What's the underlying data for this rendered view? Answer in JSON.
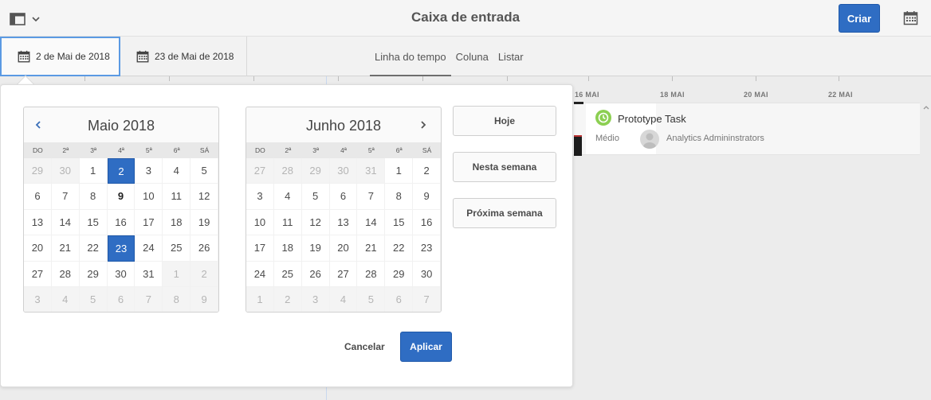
{
  "header": {
    "title": "Caixa de entrada",
    "create_label": "Criar",
    "rail_icon": "rail-toggle-icon",
    "calendar_icon": "calendar-icon"
  },
  "toolbar": {
    "start_date": "2 de Mai de 2018",
    "end_date": "23 de Mai de 2018",
    "views": [
      "Linha do tempo",
      "Coluna",
      "Listar"
    ],
    "active_view": "Linha do tempo"
  },
  "timeline": {
    "labels": [
      "16 MAI",
      "18 MAI",
      "20 MAI",
      "22 MAI"
    ],
    "task": {
      "title": "Prototype Task",
      "priority": "Médio",
      "assignee": "Analytics Admininstrators",
      "status_color": "#8ccf52"
    }
  },
  "datepicker": {
    "weekdays": [
      "DO",
      "2ª",
      "3ª",
      "4ª",
      "5ª",
      "6ª",
      "SÁ"
    ],
    "months": [
      {
        "title": "Maio 2018",
        "weeks": [
          [
            {
              "d": "29",
              "m": true
            },
            {
              "d": "30",
              "m": true
            },
            {
              "d": "1"
            },
            {
              "d": "2",
              "s": true
            },
            {
              "d": "3"
            },
            {
              "d": "4"
            },
            {
              "d": "5"
            }
          ],
          [
            {
              "d": "6"
            },
            {
              "d": "7"
            },
            {
              "d": "8"
            },
            {
              "d": "9",
              "t": true
            },
            {
              "d": "10"
            },
            {
              "d": "11"
            },
            {
              "d": "12"
            }
          ],
          [
            {
              "d": "13"
            },
            {
              "d": "14"
            },
            {
              "d": "15"
            },
            {
              "d": "16"
            },
            {
              "d": "17"
            },
            {
              "d": "18"
            },
            {
              "d": "19"
            }
          ],
          [
            {
              "d": "20"
            },
            {
              "d": "21"
            },
            {
              "d": "22"
            },
            {
              "d": "23",
              "s": true
            },
            {
              "d": "24"
            },
            {
              "d": "25"
            },
            {
              "d": "26"
            }
          ],
          [
            {
              "d": "27"
            },
            {
              "d": "28"
            },
            {
              "d": "29"
            },
            {
              "d": "30"
            },
            {
              "d": "31"
            },
            {
              "d": "1",
              "m": true
            },
            {
              "d": "2",
              "m": true
            }
          ],
          [
            {
              "d": "3",
              "m": true
            },
            {
              "d": "4",
              "m": true
            },
            {
              "d": "5",
              "m": true
            },
            {
              "d": "6",
              "m": true
            },
            {
              "d": "7",
              "m": true
            },
            {
              "d": "8",
              "m": true
            },
            {
              "d": "9",
              "m": true
            }
          ]
        ]
      },
      {
        "title": "Junho 2018",
        "weeks": [
          [
            {
              "d": "27",
              "m": true
            },
            {
              "d": "28",
              "m": true
            },
            {
              "d": "29",
              "m": true
            },
            {
              "d": "30",
              "m": true
            },
            {
              "d": "31",
              "m": true
            },
            {
              "d": "1"
            },
            {
              "d": "2"
            }
          ],
          [
            {
              "d": "3"
            },
            {
              "d": "4"
            },
            {
              "d": "5"
            },
            {
              "d": "6"
            },
            {
              "d": "7"
            },
            {
              "d": "8"
            },
            {
              "d": "9"
            }
          ],
          [
            {
              "d": "10"
            },
            {
              "d": "11"
            },
            {
              "d": "12"
            },
            {
              "d": "13"
            },
            {
              "d": "14"
            },
            {
              "d": "15"
            },
            {
              "d": "16"
            }
          ],
          [
            {
              "d": "17"
            },
            {
              "d": "18"
            },
            {
              "d": "19"
            },
            {
              "d": "20"
            },
            {
              "d": "21"
            },
            {
              "d": "22"
            },
            {
              "d": "23"
            }
          ],
          [
            {
              "d": "24"
            },
            {
              "d": "25"
            },
            {
              "d": "26"
            },
            {
              "d": "27"
            },
            {
              "d": "28"
            },
            {
              "d": "29"
            },
            {
              "d": "30"
            }
          ],
          [
            {
              "d": "1",
              "m": true
            },
            {
              "d": "2",
              "m": true
            },
            {
              "d": "3",
              "m": true
            },
            {
              "d": "4",
              "m": true
            },
            {
              "d": "5",
              "m": true
            },
            {
              "d": "6",
              "m": true
            },
            {
              "d": "7",
              "m": true
            }
          ]
        ]
      }
    ],
    "quick": {
      "today": "Hoje",
      "this_week": "Nesta semana",
      "next_week": "Próxima semana"
    },
    "cancel_label": "Cancelar",
    "apply_label": "Aplicar",
    "selected_color": "#2f6dc3"
  }
}
